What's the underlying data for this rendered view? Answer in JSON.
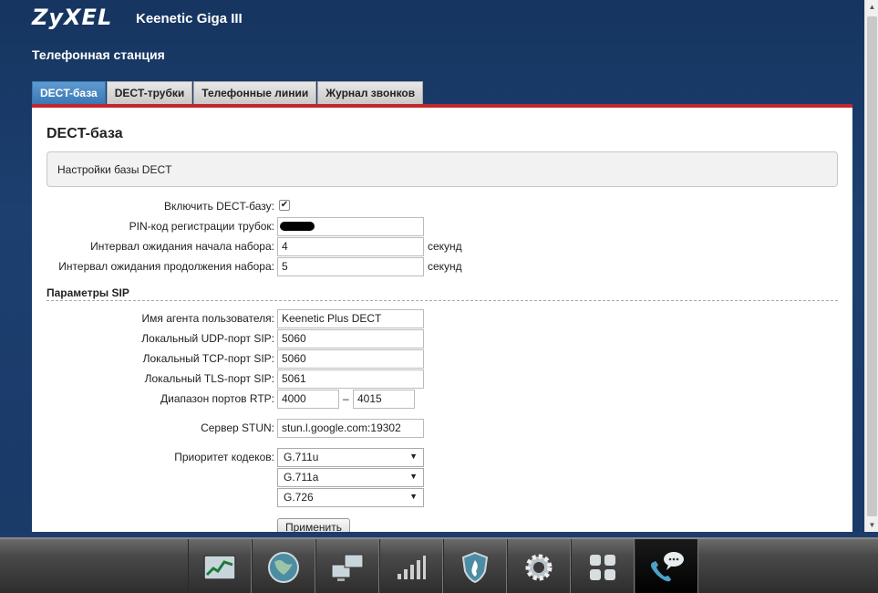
{
  "header": {
    "brand": "ZyXEL",
    "model": "Keenetic Giga III",
    "page_title": "Телефонная станция"
  },
  "tabs": [
    {
      "label": "DECT-база",
      "active": true
    },
    {
      "label": "DECT-трубки",
      "active": false
    },
    {
      "label": "Телефонные линии",
      "active": false
    },
    {
      "label": "Журнал звонков",
      "active": false
    }
  ],
  "panel": {
    "title": "DECT-база",
    "info": "Настройки базы DECT",
    "dect": {
      "enable_label": "Включить DECT-базу:",
      "enable_checked": true,
      "pin_label": "PIN-код регистрации трубок:",
      "dial_start_label": "Интервал ожидания начала набора:",
      "dial_start_value": "4",
      "dial_continue_label": "Интервал ожидания продолжения набора:",
      "dial_continue_value": "5",
      "unit": "секунд"
    },
    "sip": {
      "heading": "Параметры SIP",
      "user_agent_label": "Имя агента пользователя:",
      "user_agent_value": "Keenetic Plus DECT",
      "udp_label": "Локальный UDP-порт SIP:",
      "udp_value": "5060",
      "tcp_label": "Локальный TCP-порт SIP:",
      "tcp_value": "5060",
      "tls_label": "Локальный TLS-порт SIP:",
      "tls_value": "5061",
      "rtp_label": "Диапазон портов RTP:",
      "rtp_from": "4000",
      "rtp_sep": "–",
      "rtp_to": "4015",
      "stun_label": "Сервер STUN:",
      "stun_value": "stun.l.google.com:19302",
      "codec_label": "Приоритет кодеков:",
      "codecs": [
        "G.711u",
        "G.711a",
        "G.726"
      ]
    },
    "apply_label": "Применить"
  },
  "taskbar": {
    "items": [
      {
        "icon": "chart-icon"
      },
      {
        "icon": "globe-icon"
      },
      {
        "icon": "network-icon"
      },
      {
        "icon": "signal-icon"
      },
      {
        "icon": "shield-icon"
      },
      {
        "icon": "gear-icon"
      },
      {
        "icon": "apps-icon"
      },
      {
        "icon": "phone-icon",
        "active": true
      }
    ]
  }
}
